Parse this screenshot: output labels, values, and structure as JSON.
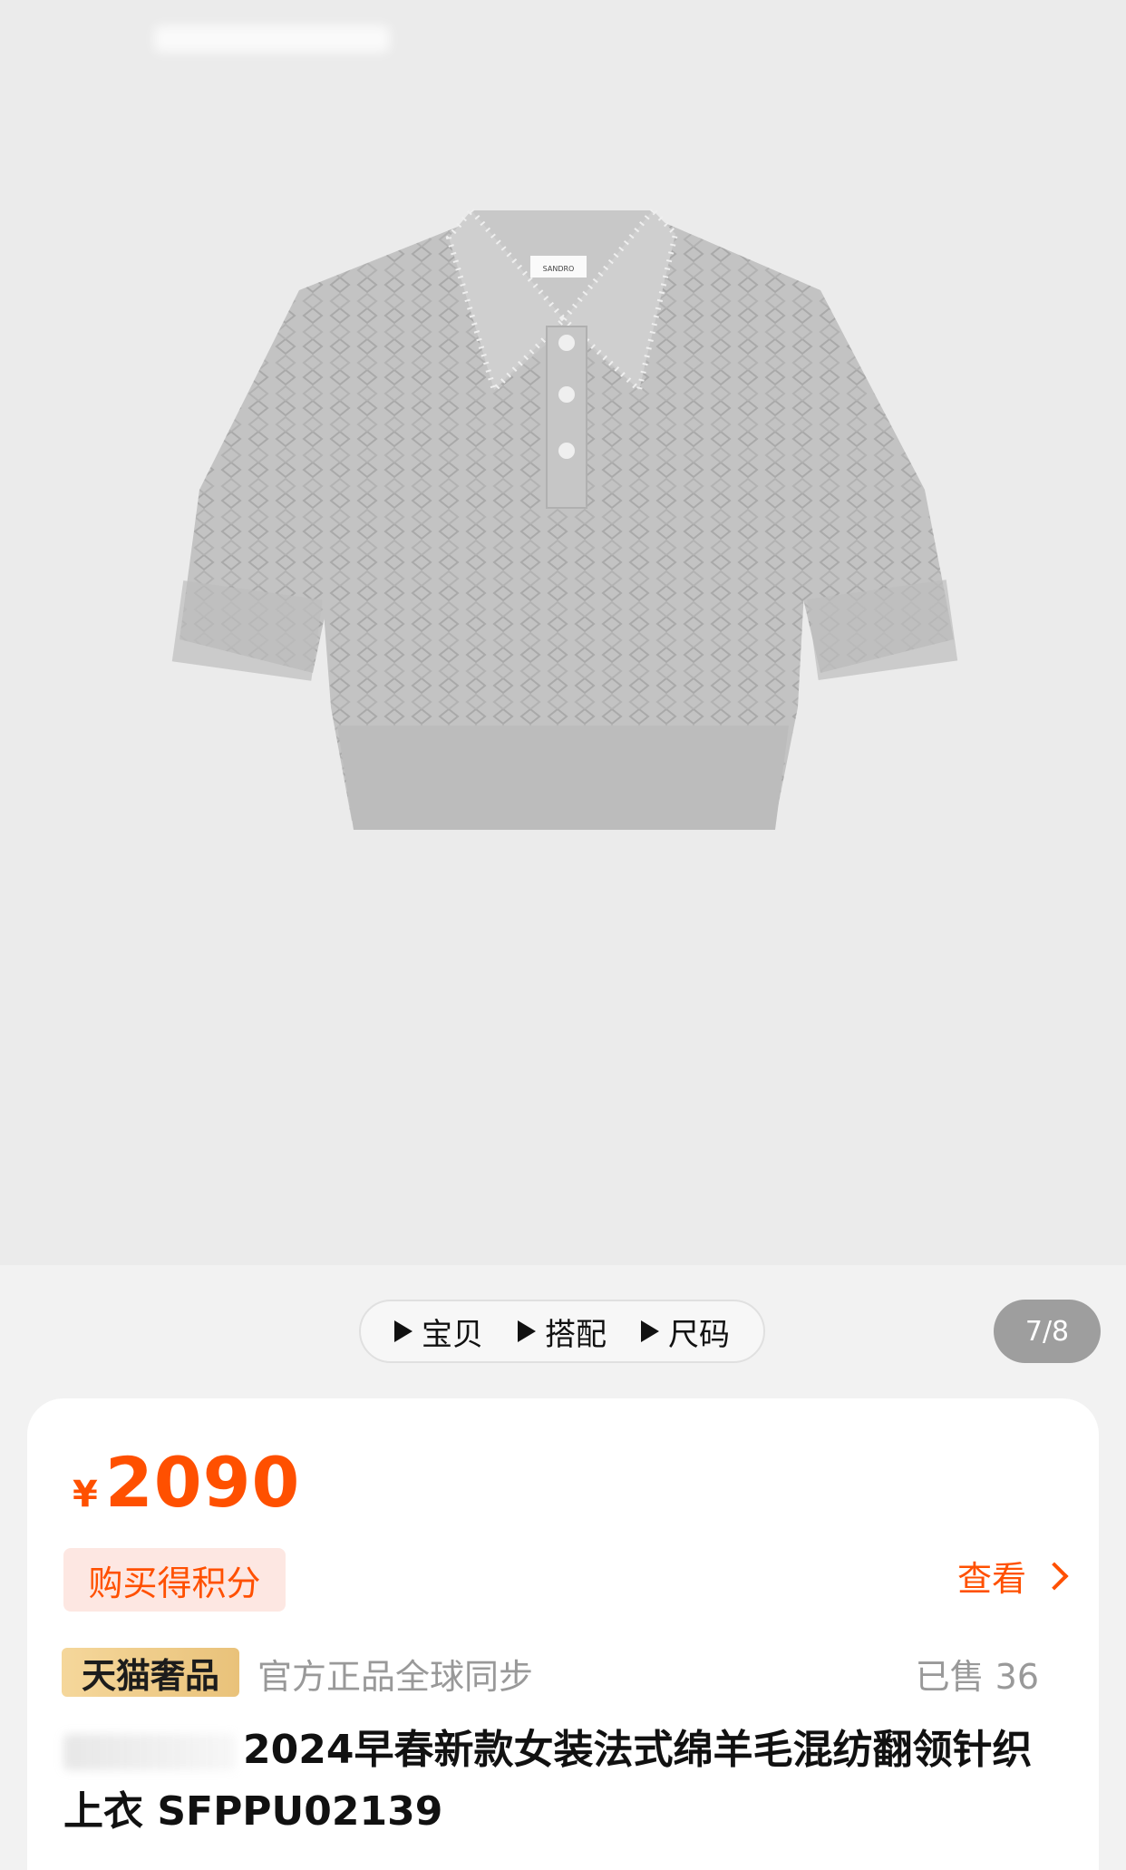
{
  "media_tabs": [
    {
      "label": "宝贝"
    },
    {
      "label": "搭配"
    },
    {
      "label": "尺码"
    }
  ],
  "page_indicator": "7/8",
  "price": {
    "currency": "¥",
    "value": "2090"
  },
  "points": {
    "badge": "购买得积分",
    "link": "查看"
  },
  "brand_badge": "天猫奢品",
  "authenticity": "官方正品全球同步",
  "sold": "已售 36",
  "title": "2024早春新款女装法式绵羊毛混纺翻领针织上衣 SFPPU02139",
  "product_image_label": "SANDRO",
  "colors": {
    "accent": "#ff5000",
    "badge_bg": "#fde7e2",
    "brand_gold": "#f5d79b"
  }
}
